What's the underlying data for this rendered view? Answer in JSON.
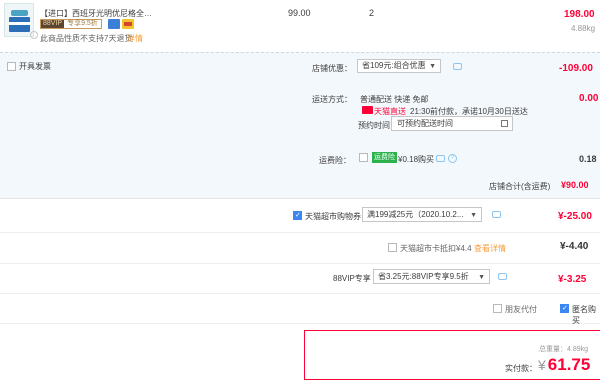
{
  "item": {
    "title": "【进口】西班牙光明优尼格全脂...",
    "vip_tag": "88VIP",
    "vip_offer": "专享9.5折",
    "no_return": "此商品性质不支持7天退货",
    "detail_link": "详情",
    "unit_price": "99.00",
    "quantity": "2",
    "subtotal": "198.00",
    "weight": "4.88kg"
  },
  "invoice": {
    "label": "开具发票",
    "checked": false
  },
  "shop_promo": {
    "label": "店铺优惠：",
    "selected": "省109元:组合优惠",
    "amount": "-109.00"
  },
  "shipping": {
    "label": "运送方式：",
    "method": "普通配送 快递 免邮",
    "tmall_label": "天猫直送",
    "time": "21:30前付款，承诺10月30日送达",
    "appointment_label": "预约时间",
    "appointment_placeholder": "可预约配送时间",
    "cost": "0.00"
  },
  "insurance": {
    "label": "运费险：",
    "tag": "运费险",
    "text": "¥0.18购买",
    "amount": "0.18",
    "checked": false
  },
  "shop_total": {
    "label": "店铺合计(含运费)",
    "amount": "¥90.00"
  },
  "coupon": {
    "label": "天猫超市购物券",
    "selected": "满199减25元（2020.10.2...",
    "amount": "¥-25.00",
    "checked": true
  },
  "card": {
    "label": "天猫超市卡抵扣¥4.4",
    "link": "查看详情",
    "amount": "¥-4.40",
    "checked": false
  },
  "vip": {
    "label": "88VIP专享",
    "selected": "省3.25元:88VIP专享9.5折",
    "amount": "¥-3.25"
  },
  "options": {
    "friend_pay": "朋友代付",
    "anonymous": "匿名购买"
  },
  "summary": {
    "total_weight": "总重量：4.89kg",
    "pay_label": "实付款：",
    "currency": "¥",
    "pay_amount": "61.75"
  },
  "colors": {
    "accent": "#ff0036",
    "link": "#f69c38",
    "check": "#3c86f4",
    "shop_bg": "#f3f8fc"
  }
}
